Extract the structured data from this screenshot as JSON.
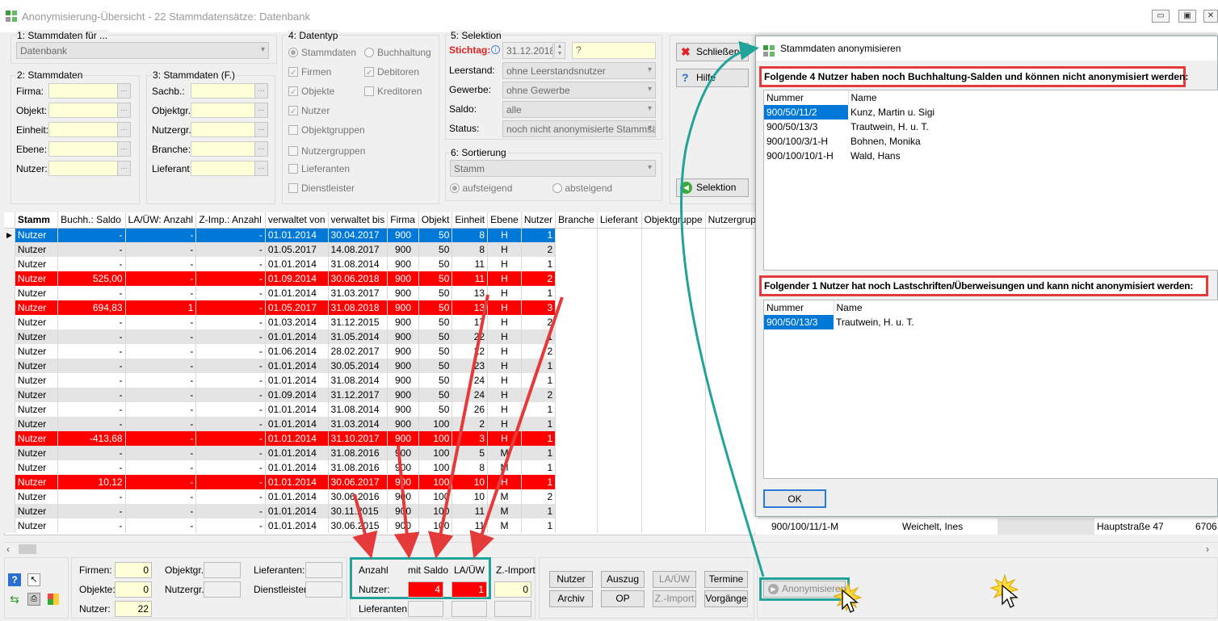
{
  "window": {
    "title": "Anonymisierung-Übersicht - 22 Stammdatensätze: Datenbank",
    "min": "▭",
    "max": "▣",
    "close": "✕"
  },
  "stammdaten_fuer": {
    "label": "1: Stammdaten für ...",
    "value": "Datenbank"
  },
  "stammdaten": {
    "label": "2: Stammdaten",
    "fields": [
      "Firma:",
      "Objekt:",
      "Einheit:",
      "Ebene:",
      "Nutzer:"
    ]
  },
  "stammdaten_f": {
    "label": "3: Stammdaten (F.)",
    "fields": [
      "Sachb.:",
      "Objektgr.:",
      "Nutzergr.:",
      "Branche:",
      "Lieferant:"
    ]
  },
  "datentyp": {
    "label": "4: Datentyp",
    "options": [
      "Stammdaten",
      "Buchhaltung",
      "Firmen",
      "Debitoren",
      "Objekte",
      "Kreditoren",
      "Nutzer",
      "Objektgruppen",
      "Nutzergruppen",
      "Lieferanten",
      "Dienstleister"
    ]
  },
  "selektion": {
    "label": "5: Selektion",
    "stichtag_label": "Stichtag:",
    "stichtag_value": "31.12.2018",
    "stichtag_extra": "?",
    "rows": [
      {
        "label": "Leerstand:",
        "value": "ohne Leerstandsnutzer"
      },
      {
        "label": "Gewerbe:",
        "value": "ohne Gewerbe"
      },
      {
        "label": "Saldo:",
        "value": "alle"
      },
      {
        "label": "Status:",
        "value": "noch nicht anonymisierte Stammsät"
      }
    ]
  },
  "sortierung": {
    "label": "6: Sortierung",
    "value": "Stamm",
    "asc": "aufsteigend",
    "desc": "absteigend"
  },
  "side_buttons": {
    "close": "Schließen",
    "help": "Hilfe",
    "selektion": "Selektion"
  },
  "grid": {
    "columns": [
      "Stamm",
      "Buchh.: Saldo",
      "LA/ÜW: Anzahl",
      "Z-Imp.: Anzahl",
      "verwaltet von",
      "verwaltet bis",
      "Firma",
      "Objekt",
      "Einheit",
      "Ebene",
      "Nutzer",
      "Branche",
      "Lieferant",
      "Objektgruppe",
      "Nutzergrup"
    ],
    "rows": [
      {
        "s": "blue",
        "c": [
          "Nutzer",
          "-",
          "-",
          "-",
          "01.01.2014",
          "30.04.2017",
          "900",
          "50",
          "8",
          "H",
          "1"
        ]
      },
      {
        "s": "alt",
        "c": [
          "Nutzer",
          "-",
          "-",
          "-",
          "01.05.2017",
          "14.08.2017",
          "900",
          "50",
          "8",
          "H",
          "2"
        ]
      },
      {
        "s": "wht",
        "c": [
          "Nutzer",
          "-",
          "-",
          "-",
          "01.01.2014",
          "31.08.2014",
          "900",
          "50",
          "11",
          "H",
          "1"
        ]
      },
      {
        "s": "red",
        "c": [
          "Nutzer",
          "525,00",
          "-",
          "-",
          "01.09.2014",
          "30.06.2018",
          "900",
          "50",
          "11",
          "H",
          "2"
        ]
      },
      {
        "s": "wht",
        "c": [
          "Nutzer",
          "-",
          "-",
          "-",
          "01.01.2014",
          "31.03.2017",
          "900",
          "50",
          "13",
          "H",
          "1"
        ]
      },
      {
        "s": "red",
        "c": [
          "Nutzer",
          "694,83",
          "1",
          "-",
          "01.05.2017",
          "31.08.2018",
          "900",
          "50",
          "13",
          "H",
          "3"
        ]
      },
      {
        "s": "wht",
        "c": [
          "Nutzer",
          "-",
          "-",
          "-",
          "01.03.2014",
          "31.12.2015",
          "900",
          "50",
          "17",
          "H",
          "2"
        ]
      },
      {
        "s": "alt",
        "c": [
          "Nutzer",
          "-",
          "-",
          "-",
          "01.01.2014",
          "31.05.2014",
          "900",
          "50",
          "22",
          "H",
          "1"
        ]
      },
      {
        "s": "wht",
        "c": [
          "Nutzer",
          "-",
          "-",
          "-",
          "01.06.2014",
          "28.02.2017",
          "900",
          "50",
          "22",
          "H",
          "2"
        ]
      },
      {
        "s": "alt",
        "c": [
          "Nutzer",
          "-",
          "-",
          "-",
          "01.01.2014",
          "30.05.2014",
          "900",
          "50",
          "23",
          "H",
          "1"
        ]
      },
      {
        "s": "wht",
        "c": [
          "Nutzer",
          "-",
          "-",
          "-",
          "01.01.2014",
          "31.08.2014",
          "900",
          "50",
          "24",
          "H",
          "1"
        ]
      },
      {
        "s": "alt",
        "c": [
          "Nutzer",
          "-",
          "-",
          "-",
          "01.09.2014",
          "31.12.2017",
          "900",
          "50",
          "24",
          "H",
          "2"
        ]
      },
      {
        "s": "wht",
        "c": [
          "Nutzer",
          "-",
          "-",
          "-",
          "01.01.2014",
          "31.08.2014",
          "900",
          "50",
          "26",
          "H",
          "1"
        ]
      },
      {
        "s": "alt",
        "c": [
          "Nutzer",
          "-",
          "-",
          "-",
          "01.01.2014",
          "31.03.2014",
          "900",
          "100",
          "2",
          "H",
          "1"
        ]
      },
      {
        "s": "red",
        "c": [
          "Nutzer",
          "-413,68",
          "-",
          "-",
          "01.01.2014",
          "31.10.2017",
          "900",
          "100",
          "3",
          "H",
          "1"
        ]
      },
      {
        "s": "alt",
        "c": [
          "Nutzer",
          "-",
          "-",
          "-",
          "01.01.2014",
          "31.08.2016",
          "900",
          "100",
          "5",
          "M",
          "1"
        ]
      },
      {
        "s": "wht",
        "c": [
          "Nutzer",
          "-",
          "-",
          "-",
          "01.01.2014",
          "31.08.2016",
          "900",
          "100",
          "8",
          "M",
          "1"
        ]
      },
      {
        "s": "red",
        "c": [
          "Nutzer",
          "10,12",
          "-",
          "-",
          "01.01.2014",
          "30.06.2017",
          "900",
          "100",
          "10",
          "H",
          "1"
        ]
      },
      {
        "s": "wht",
        "c": [
          "Nutzer",
          "-",
          "-",
          "-",
          "01.01.2014",
          "30.06.2016",
          "900",
          "100",
          "10",
          "M",
          "2"
        ]
      },
      {
        "s": "alt",
        "c": [
          "Nutzer",
          "-",
          "-",
          "-",
          "01.01.2014",
          "30.11.2015",
          "900",
          "100",
          "11",
          "M",
          "1"
        ]
      },
      {
        "s": "wht",
        "c": [
          "Nutzer",
          "-",
          "-",
          "-",
          "01.01.2014",
          "30.06.2015",
          "900",
          "100",
          "11",
          "M",
          "1"
        ]
      }
    ]
  },
  "behind_row": {
    "nummer": "900/100/11/1-M",
    "name": "Weichelt, Ines",
    "strasse": "Hauptstraße 47",
    "plz": "6706"
  },
  "dialog": {
    "title": "Stammdaten anonymisieren",
    "box1_title": "Folgende 4 Nutzer haben noch Buchhaltung-Salden und können nicht anonymisiert werden:",
    "box1_columns": [
      "Nummer",
      "Name"
    ],
    "box1_rows": [
      [
        "900/50/11/2",
        "Kunz, Martin u. Sigi"
      ],
      [
        "900/50/13/3",
        "Trautwein, H. u. T."
      ],
      [
        "900/100/3/1-H",
        "Bohnen, Monika"
      ],
      [
        "900/100/10/1-H",
        "Wald, Hans"
      ]
    ],
    "box2_title": "Folgender 1 Nutzer hat noch Lastschriften/Überweisungen und kann nicht anonymisiert werden:",
    "box2_columns": [
      "Nummer",
      "Name"
    ],
    "box2_rows": [
      [
        "900/50/13/3",
        "Trautwein, H. u. T."
      ]
    ],
    "ok": "OK"
  },
  "footer": {
    "firmen": {
      "label": "Firmen:",
      "value": "0"
    },
    "objekte": {
      "label": "Objekte:",
      "value": "0"
    },
    "nutzer": {
      "label": "Nutzer:",
      "value": "22"
    },
    "objektgr": "Objektgr.:",
    "nutzergr": "Nutzergr.:",
    "lieferanten": "Lieferanten:",
    "dienstleister": "Dienstleister:",
    "anzahl": "Anzahl",
    "mit_saldo": "mit Saldo",
    "la_uw": "LA/ÜW",
    "z_import": "Z.-Import",
    "nutzer2": "Nutzer:",
    "saldo_value": "4",
    "lauw_value": "1",
    "zimport_value": "0",
    "lieferanten2": "Lieferanten:",
    "buttons": [
      "Nutzer",
      "Auszug",
      "LA/ÜW",
      "Termine",
      "Archiv",
      "OP",
      "Z.-Import",
      "Vorgänge"
    ],
    "anonymisieren": "Anonymisieren"
  }
}
